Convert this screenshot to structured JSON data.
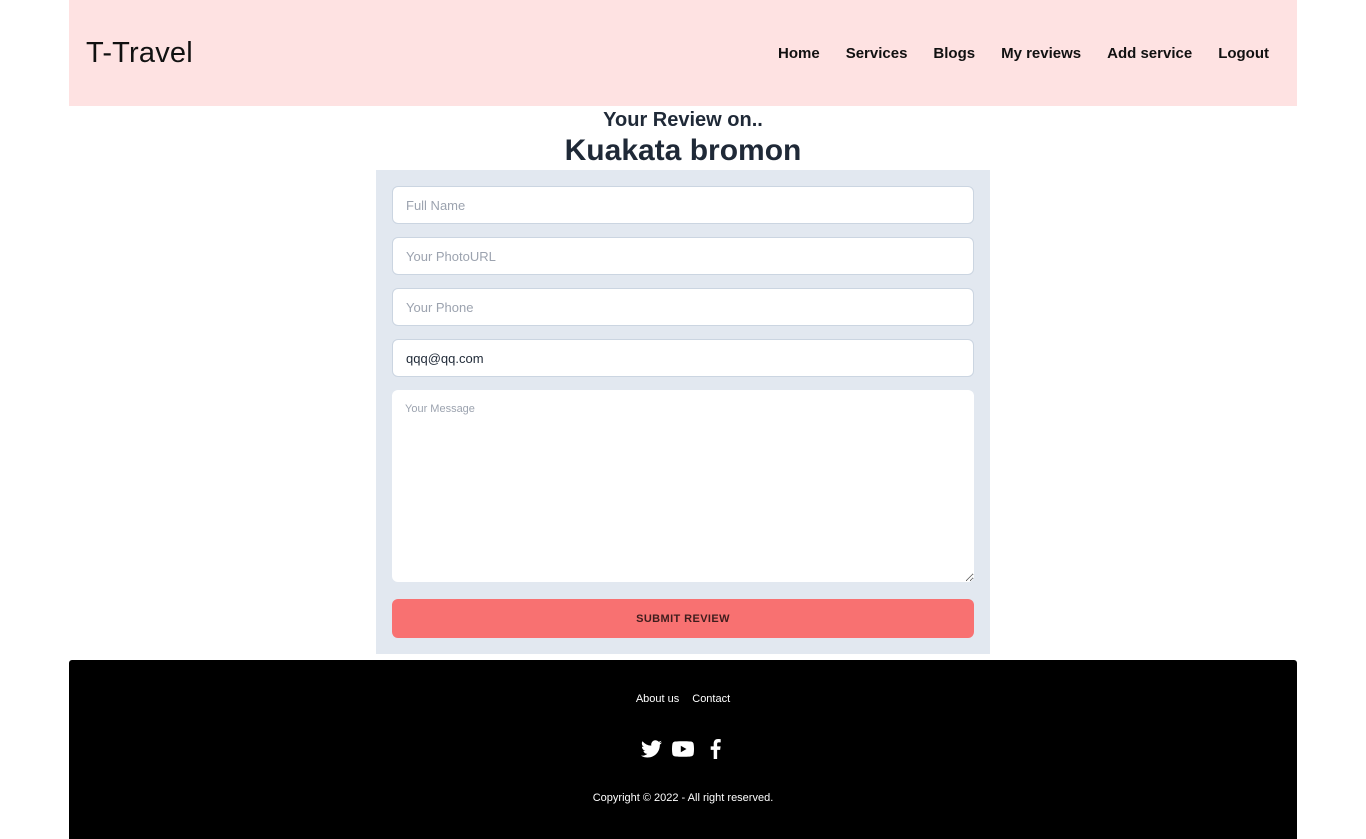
{
  "header": {
    "brand": "T-Travel",
    "background": "#fee2e2",
    "nav": [
      {
        "label": "Home"
      },
      {
        "label": "Services"
      },
      {
        "label": "Blogs"
      },
      {
        "label": "My reviews"
      },
      {
        "label": "Add service"
      },
      {
        "label": "Logout"
      }
    ]
  },
  "page": {
    "subtitle": "Your Review on..",
    "title": "Kuakata bromon"
  },
  "form": {
    "full_name": {
      "placeholder": "Full Name",
      "value": ""
    },
    "photo_url": {
      "placeholder": "Your PhotoURL",
      "value": ""
    },
    "phone": {
      "placeholder": "Your Phone",
      "value": ""
    },
    "email": {
      "placeholder": "",
      "value": "qqq@qq.com"
    },
    "message": {
      "placeholder": "Your Message",
      "value": ""
    },
    "submit_label": "SUBMIT REVIEW",
    "background": "#e2e8f0",
    "submit_color": "#f87171"
  },
  "footer": {
    "links": [
      {
        "label": "About us"
      },
      {
        "label": "Contact"
      }
    ],
    "social_icons": [
      "twitter-icon",
      "youtube-icon",
      "facebook-icon"
    ],
    "copyright": "Copyright © 2022 - All right reserved."
  }
}
